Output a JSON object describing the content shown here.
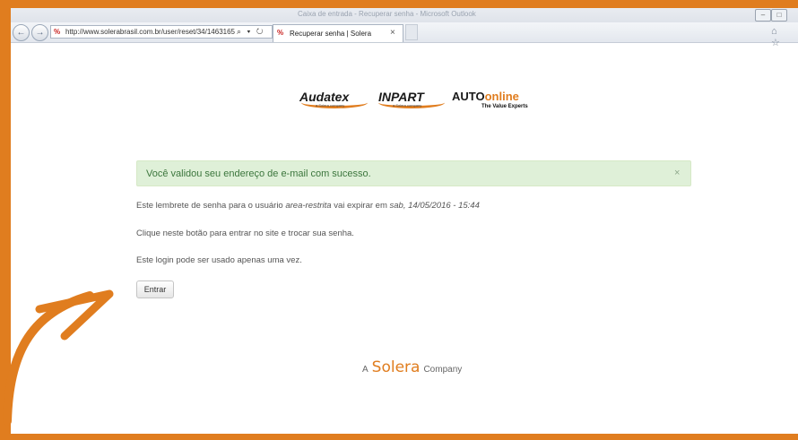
{
  "browser": {
    "window_title": "Caixa de entrada - Recuperar senha - Microsoft Outlook",
    "url": "http://www.solerabrasil.com.br/user/reset/34/1463165",
    "tab_label": "Recuperar senha | Solera",
    "tab_close": "×",
    "back": "←",
    "forward": "→",
    "addr_icons": "⌕ ▾ ↻",
    "right_icons": "⌂ ☆",
    "min": "–",
    "max": "□"
  },
  "logos": {
    "audatex": "Audatex",
    "inpart": "INPART",
    "sub": "a Solera company",
    "auto_prefix": "AUTO",
    "auto_suffix": "online",
    "tagline": "The Value Experts"
  },
  "alert": {
    "text": "Você validou seu endereço de e-mail com sucesso.",
    "close": "×"
  },
  "messages": {
    "line1_a": "Este lembrete de senha para o usuário ",
    "line1_user": "area-restrita",
    "line1_b": " vai expirar em ",
    "line1_date": "sab, 14/05/2016 - 15:44",
    "line2": "Clique neste botão para entrar no site e trocar sua senha.",
    "line3": "Este login pode ser usado apenas uma vez."
  },
  "button": {
    "label": "Entrar"
  },
  "footer": {
    "prefix": "A",
    "brand": "Solera",
    "suffix": "Company"
  },
  "colors": {
    "accent": "#e07d1f",
    "alert_bg": "#dff0d8",
    "alert_text": "#3c763d"
  }
}
